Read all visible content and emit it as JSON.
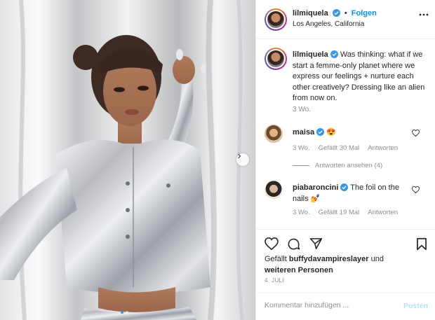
{
  "post": {
    "author": {
      "username": "lilmiquela",
      "verified": true,
      "follow_label": "Folgen",
      "location": "Los Angeles, California"
    },
    "caption": {
      "username": "lilmiquela",
      "text": "Was thinking: what if we start a femme-only planet where we express our feelings + nurture each other creatively? Dressing like an alien from now on.",
      "time": "3 Wo."
    },
    "comments": [
      {
        "username": "maisa",
        "text": "😍",
        "time": "3 Wo.",
        "likes": "Gefällt 30 Mal",
        "reply_label": "Antworten",
        "view_replies": "Antworten ansehen (4)"
      },
      {
        "username": "piabaroncini",
        "text": "The foil on the nails 💅",
        "time": "3 Wo.",
        "likes": "Gefällt 19 Mal",
        "reply_label": "Antworten"
      }
    ],
    "liked_by_prefix": "Gefällt",
    "liked_by_user": "buffydavampireslayer",
    "liked_by_and": "und",
    "liked_by_others": "weiteren Personen",
    "date": "4. JULI",
    "comment_placeholder": "Kommentar hinzufügen ...",
    "post_button": "Posten",
    "carousel": {
      "slides": 2,
      "active_index": 0
    }
  },
  "icons": {
    "verified": "verified-badge-icon",
    "more": "more-options-icon",
    "heart": "heart-icon",
    "comment": "comment-bubble-icon",
    "share": "paper-plane-icon",
    "save": "bookmark-icon",
    "next": "chevron-right-icon"
  },
  "colors": {
    "accent": "#0095f6",
    "verified": "#3897f0",
    "text": "#262626",
    "muted": "#8e8e8e",
    "post_button_disabled": "#b2dffc"
  }
}
